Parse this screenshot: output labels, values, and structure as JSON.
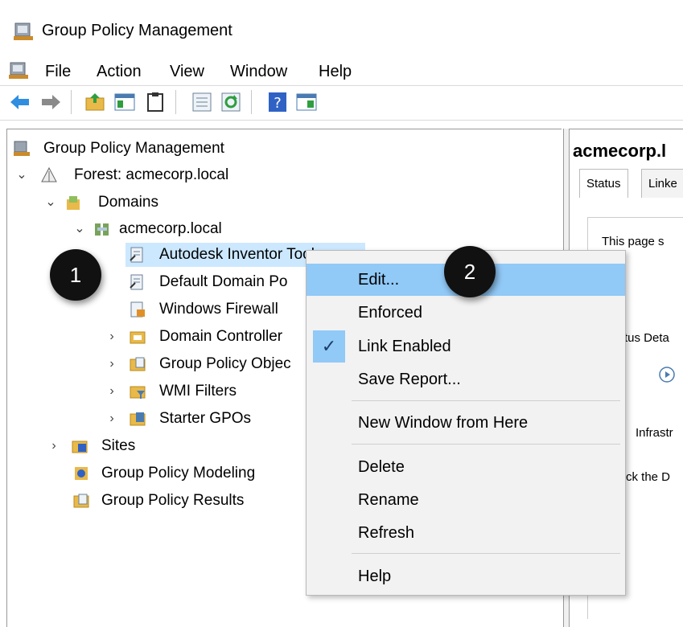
{
  "window": {
    "title": "Group Policy Management"
  },
  "menu": [
    "File",
    "Action",
    "View",
    "Window",
    "Help"
  ],
  "toolbar": {
    "buttons": [
      "back-arrow",
      "forward-arrow",
      "up-folder",
      "show-hide-tree",
      "clipboard",
      "export-list",
      "refresh",
      "help",
      "properties"
    ]
  },
  "tree": {
    "root": "Group Policy Management",
    "forest": "Forest: acmecorp.local",
    "domains": "Domains",
    "domain": "acmecorp.local",
    "gpo_autodesk": "Autodesk Inventor Tool",
    "gpo_default": "Default Domain Po",
    "gpo_firewall": "Windows Firewall",
    "domain_controllers": "Domain Controller",
    "gpo_objects": "Group Policy Objec",
    "wmi": "WMI Filters",
    "starter": "Starter GPOs",
    "sites": "Sites",
    "modeling": "Group Policy Modeling",
    "results": "Group Policy Results"
  },
  "right": {
    "title": "acmecorp.l",
    "tabs": [
      "Status",
      "Linke"
    ],
    "line1": "This page s",
    "line2": "tus Deta",
    "line3": "Infrastr",
    "line4": "ck the D"
  },
  "context_menu": {
    "items": {
      "edit": "Edit...",
      "enforced": "Enforced",
      "link_enabled": "Link Enabled",
      "save_report": "Save Report...",
      "new_window": "New Window from Here",
      "delete": "Delete",
      "rename": "Rename",
      "refresh": "Refresh",
      "help": "Help"
    },
    "checked": "Link Enabled",
    "highlighted": "Edit..."
  },
  "callouts": {
    "one": "1",
    "two": "2"
  },
  "colors": {
    "selection": "#cce8ff",
    "menu_highlight": "#91c9f7",
    "menu_bg": "#f2f2f2"
  }
}
